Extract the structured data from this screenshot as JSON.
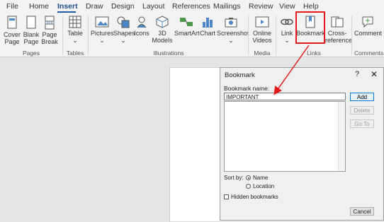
{
  "tabs": [
    "File",
    "Home",
    "Insert",
    "Draw",
    "Design",
    "Layout",
    "References",
    "Mailings",
    "Review",
    "View",
    "Help"
  ],
  "active_tab": "Insert",
  "ribbon": {
    "pages": {
      "cover_page": "Cover Page",
      "blank_page": "Blank Page",
      "page_break": "Page Break",
      "label": "Pages"
    },
    "tables": {
      "table": "Table",
      "label": "Tables"
    },
    "illustrations": {
      "pictures": "Pictures",
      "shapes": "Shapes",
      "icons": "Icons",
      "models_3d": "3D Models",
      "smartart": "SmartArt",
      "chart": "Chart",
      "screenshot": "Screenshot",
      "label": "Illustrations"
    },
    "media": {
      "online_videos": "Online Videos",
      "label": "Media"
    },
    "links": {
      "link": "Link",
      "bookmark": "Bookmark",
      "cross_reference": "Cross-reference",
      "label": "Links"
    },
    "comments": {
      "comment": "Comment",
      "label": "Comments"
    }
  },
  "dialog": {
    "title": "Bookmark",
    "help": "?",
    "close": "✕",
    "name_label": "Bookmark name:",
    "name_value": "IMPORTANT",
    "add": "Add",
    "delete": "Delete",
    "goto": "Go To",
    "sort_by": "Sort by:",
    "sort_name": "Name",
    "sort_location": "Location",
    "hidden": "Hidden bookmarks",
    "cancel": "Cancel"
  },
  "accent": "#e31a1a"
}
